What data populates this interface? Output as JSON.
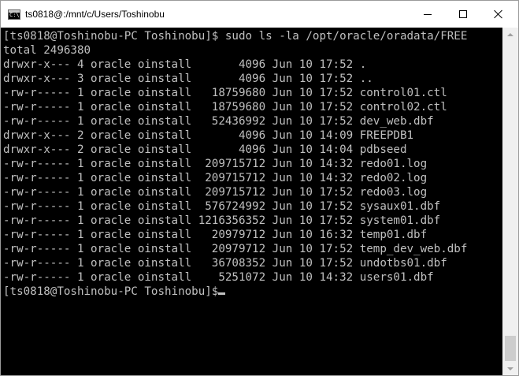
{
  "window": {
    "title": "ts0818@:/mnt/c/Users/Toshinobu",
    "icon_prompt": "C:\\"
  },
  "terminal": {
    "lines": [
      "[ts0818@Toshinobu-PC Toshinobu]$ sudo ls -la /opt/oracle/oradata/FREE",
      "total 2496380",
      "drwxr-x--- 4 oracle oinstall       4096 Jun 10 17:52 .",
      "drwxr-x--- 3 oracle oinstall       4096 Jun 10 17:52 ..",
      "-rw-r----- 1 oracle oinstall   18759680 Jun 10 17:52 control01.ctl",
      "-rw-r----- 1 oracle oinstall   18759680 Jun 10 17:52 control02.ctl",
      "-rw-r----- 1 oracle oinstall   52436992 Jun 10 17:52 dev_web.dbf",
      "drwxr-x--- 2 oracle oinstall       4096 Jun 10 14:09 FREEPDB1",
      "drwxr-x--- 2 oracle oinstall       4096 Jun 10 14:04 pdbseed",
      "-rw-r----- 1 oracle oinstall  209715712 Jun 10 14:32 redo01.log",
      "-rw-r----- 1 oracle oinstall  209715712 Jun 10 14:32 redo02.log",
      "-rw-r----- 1 oracle oinstall  209715712 Jun 10 17:52 redo03.log",
      "-rw-r----- 1 oracle oinstall  576724992 Jun 10 17:52 sysaux01.dbf",
      "-rw-r----- 1 oracle oinstall 1216356352 Jun 10 17:52 system01.dbf",
      "-rw-r----- 1 oracle oinstall   20979712 Jun 10 16:32 temp01.dbf",
      "-rw-r----- 1 oracle oinstall   20979712 Jun 10 17:52 temp_dev_web.dbf",
      "-rw-r----- 1 oracle oinstall   36708352 Jun 10 17:52 undotbs01.dbf",
      "-rw-r----- 1 oracle oinstall    5251072 Jun 10 14:32 users01.dbf",
      "[ts0818@Toshinobu-PC Toshinobu]$"
    ]
  },
  "colors": {
    "console_background": "#000000",
    "console_text": "#c0c0c0",
    "titlebar_background": "#ffffff"
  },
  "icons": {
    "app": "console-icon",
    "minimize": "minimize-icon",
    "maximize": "maximize-icon",
    "close": "close-icon"
  }
}
